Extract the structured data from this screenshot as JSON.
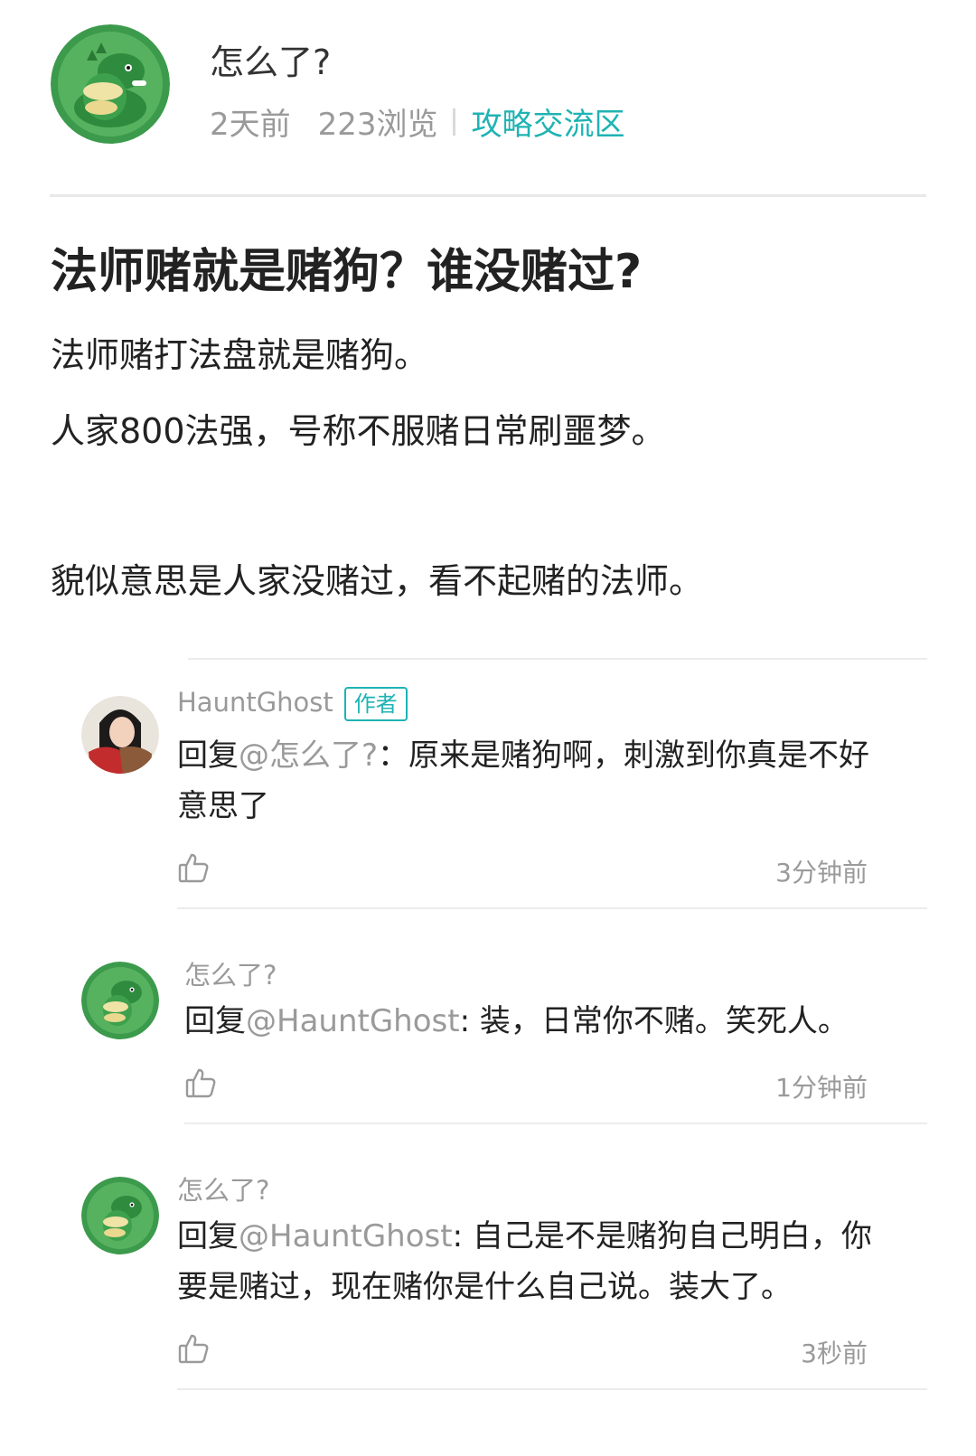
{
  "author": {
    "name": "怎么了?",
    "posted": "2天前",
    "views": "223浏览",
    "section": "攻略交流区"
  },
  "post": {
    "title": "法师赌就是赌狗？谁没赌过?",
    "paragraphs": [
      "法师赌打法盘就是赌狗。",
      "人家800法强，号称不服赌日常刷噩梦。",
      "貌似意思是人家没赌过，看不起赌的法师。"
    ]
  },
  "comments": [
    {
      "name": "HauntGhost",
      "badge": "作者",
      "reply_prefix": "回复",
      "mention": "@怎么了?",
      "text_line1": "：原来是赌狗啊，刺激到你真是不好",
      "text_line2": "意思了",
      "time": "3分钟前"
    },
    {
      "name": "怎么了?",
      "reply_prefix": "回复",
      "mention": "@HauntGhost",
      "text_line1": ": 装，日常你不赌。笑死人。",
      "time": "1分钟前"
    },
    {
      "name": "怎么了?",
      "reply_prefix": "回复",
      "mention": "@HauntGhost",
      "text_line1": ": 自己是不是赌狗自己明白，你",
      "text_line2": "要是赌过，现在赌你是什么自己说。装大了。",
      "time": "3秒前"
    }
  ],
  "colors": {
    "accent": "#1fb3b3",
    "muted": "#9a9a9a",
    "text": "#222222",
    "divider": "#ececec"
  },
  "icons": [
    "dinosaur-avatar",
    "anime-avatar",
    "thumbs-up-icon"
  ]
}
